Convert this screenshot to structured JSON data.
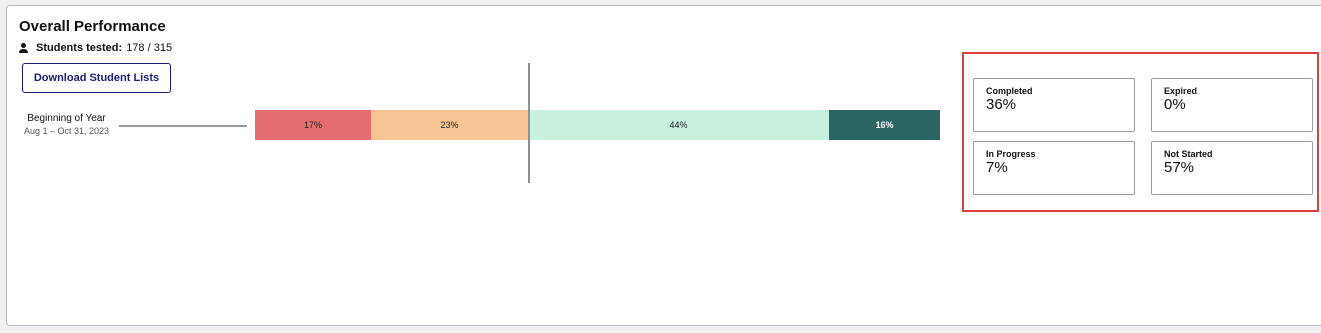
{
  "header": {
    "title": "Overall Performance",
    "students_tested_label": "Students tested:",
    "students_tested_value": "178 / 315",
    "download_label": "Download Student Lists"
  },
  "period": {
    "name": "Beginning of Year",
    "range": "Aug 1 – Oct 31, 2023"
  },
  "chart_data": {
    "type": "bar",
    "categories": [
      "Beginning of Year"
    ],
    "series": [
      {
        "values": [
          17
        ],
        "label": "17%",
        "color": "#e46d6f"
      },
      {
        "values": [
          23
        ],
        "label": "23%",
        "color": "#f6c493"
      },
      {
        "values": [
          44
        ],
        "label": "44%",
        "color": "#c8f0de"
      },
      {
        "values": [
          16
        ],
        "label": "16%",
        "color": "#2b6664"
      }
    ],
    "stacked": true,
    "orientation": "horizontal"
  },
  "status": {
    "completed_label": "Completed",
    "completed_value": "36%",
    "expired_label": "Expired",
    "expired_value": "0%",
    "in_progress_label": "In Progress",
    "in_progress_value": "7%",
    "not_started_label": "Not Started",
    "not_started_value": "57%"
  },
  "colors": {
    "highlight_border": "#e03d3d",
    "button_accent": "#1c1a7a"
  }
}
